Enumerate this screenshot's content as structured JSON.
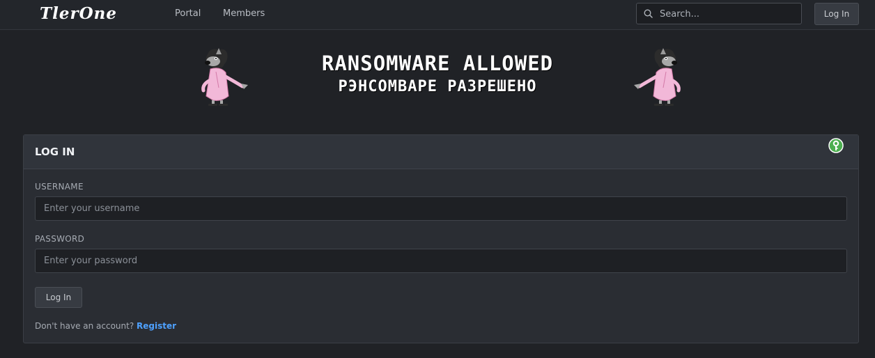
{
  "header": {
    "logo": "TlerOne",
    "nav": [
      {
        "label": "Portal"
      },
      {
        "label": "Members"
      }
    ],
    "search": {
      "placeholder": "Search..."
    },
    "login_label": "Log In"
  },
  "banner": {
    "title_en": "RANSOMWARE ALLOWED",
    "title_ru": "РЭНСОМВАРЕ РАЗРЕШЕНО"
  },
  "login_panel": {
    "title": "LOG IN",
    "username": {
      "label": "USERNAME",
      "placeholder": "Enter your username"
    },
    "password": {
      "label": "PASSWORD",
      "placeholder": "Enter your password"
    },
    "submit_label": "Log In",
    "no_account_text": "Don't have an account?",
    "register_label": "Register"
  },
  "colors": {
    "background": "#202226",
    "panel": "#2a2d33",
    "link": "#4ea1ff",
    "key_icon": "#4caf50"
  },
  "icons": [
    "search-icon",
    "wolf-cartoon-left",
    "wolf-cartoon-right",
    "key-icon"
  ]
}
